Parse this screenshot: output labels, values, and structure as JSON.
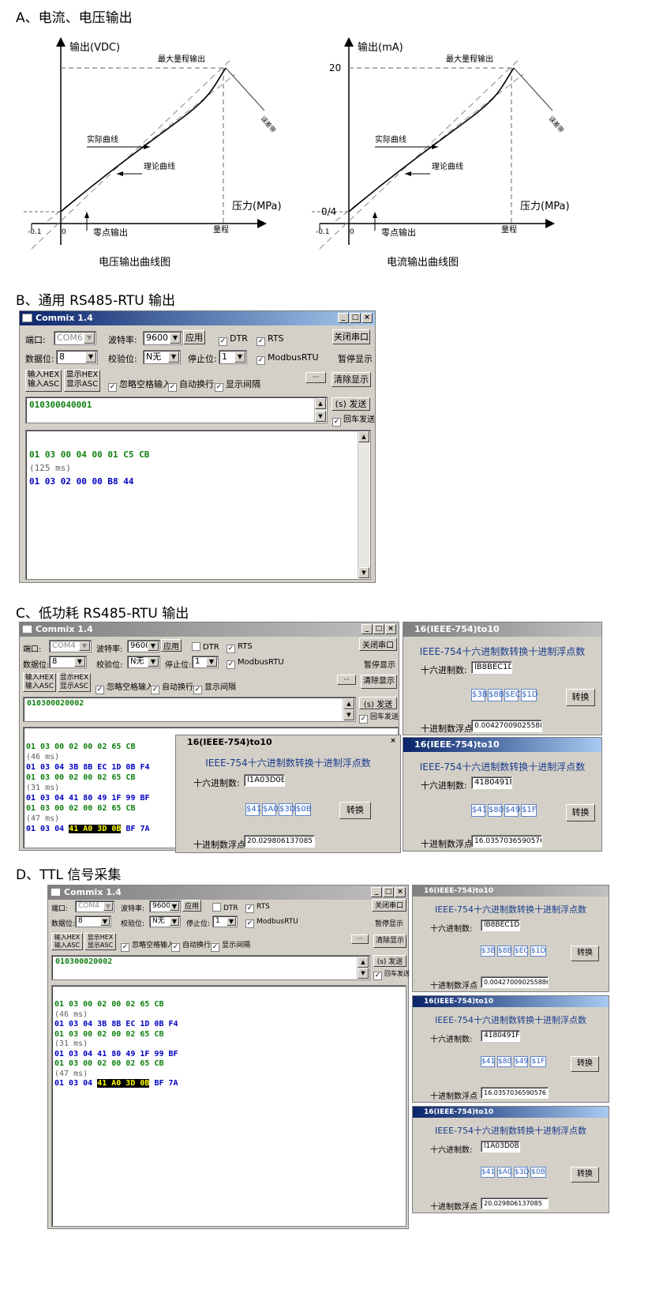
{
  "sections": {
    "a": "A、电流、电压输出",
    "b": "B、通用 RS485-RTU 输出",
    "c": "C、低功耗 RS485-RTU 输出",
    "d": "D、TTL 信号采集"
  },
  "voltage_chart": {
    "ylabel": "输出(VDC)",
    "xlabel": "压力(MPa)",
    "max_label": "最大量程输出",
    "error_label": "误差带",
    "actual_label": "实际曲线",
    "theory_label": "理论曲线",
    "zero_label": "零点输出",
    "range_label": "量程",
    "neg": "-0.1",
    "zero": "0",
    "caption": "电压输出曲线图"
  },
  "current_chart": {
    "ylabel": "输出(mA)",
    "xlabel": "压力(MPa)",
    "max_label": "最大量程输出",
    "error_label": "误差带",
    "actual_label": "实际曲线",
    "theory_label": "理论曲线",
    "zero_label": "零点输出",
    "range_label": "量程",
    "neg": "-0.1",
    "zero": "0",
    "y_top": "20",
    "y_bottom": "0/4",
    "caption": "电流输出曲线图"
  },
  "commix": {
    "title": "Commix 1.4",
    "port_label": "端口:",
    "baud_label": "波特率:",
    "apply": "应用",
    "dtr": "DTR",
    "rts": "RTS",
    "close_port": "关闭串口",
    "databits_label": "数据位:",
    "databits": "8",
    "parity_label": "校验位:",
    "parity": "N无",
    "stopbits_label": "停止位:",
    "stopbits": "1",
    "modbus": "ModbusRTU",
    "pause": "暂停显示",
    "in_hex": "输入HEX",
    "in_asc": "输入ASC",
    "show_hex": "显示HEX",
    "show_asc": "显示ASC",
    "ignore_space": "忽略空格输入",
    "auto_wrap": "自动换行",
    "show_interval": "显示间隔",
    "dots": "···",
    "clear": "清除显示",
    "send": "(s) 发送",
    "enter_send": "回车发送",
    "min": "_",
    "max": "□",
    "close": "×"
  },
  "b_win": {
    "port": "COM6",
    "baud": "9600",
    "input": "010300040001",
    "lines": [
      {
        "t": "01 03 00 04 00 01 C5 CB",
        "c": "g"
      },
      {
        "t": "(125 ms)",
        "c": "gr"
      },
      {
        "t": "01 03 02 00 00 B8 44",
        "c": "b"
      }
    ]
  },
  "c_win": {
    "port": "COM4",
    "baud": "9600",
    "input": "010300020002",
    "lines": [
      {
        "t": "01 03 00 02 00 02 65 CB",
        "c": "g"
      },
      {
        "t": "(46 ms)",
        "c": "gr"
      },
      {
        "t": "01 03 04 3B 8B EC 1D 0B F4",
        "c": "b"
      },
      {
        "t": "01 03 00 02 00 02 65 CB",
        "c": "g"
      },
      {
        "t": "(31 ms)",
        "c": "gr"
      },
      {
        "t": "01 03 04 41 80 49 1F 99 BF",
        "c": "b"
      },
      {
        "t": "01 03 00 02 00 02 65 CB",
        "c": "g"
      },
      {
        "t": "(47 ms)",
        "c": "gr"
      }
    ],
    "last_pre": "01 03 04 ",
    "last_hl": "41 A0 3D 0B",
    "last_post": " BF 7A"
  },
  "ieee": {
    "title": "16(IEEE-754)to10",
    "heading": "IEEE-754十六进制数转换十进制浮点数",
    "hex_label": "十六进制数:",
    "convert": "转换",
    "dec_label": "十进制数浮点",
    "close": "×"
  },
  "ieee_values": [
    {
      "hex": "lB8BEC1D",
      "bytes": [
        "$3B",
        "$8B",
        "$EC",
        "$1D"
      ],
      "dec": "0.0042700902558863"
    },
    {
      "hex": "4180491F",
      "bytes": [
        "$41",
        "$80",
        "$49",
        "$1F"
      ],
      "dec": "16.0357036590576"
    },
    {
      "hex": "l1A03D0B",
      "bytes": [
        "$41",
        "$A0",
        "$3D",
        "$0B"
      ],
      "dec": "20.029806137085"
    }
  ]
}
